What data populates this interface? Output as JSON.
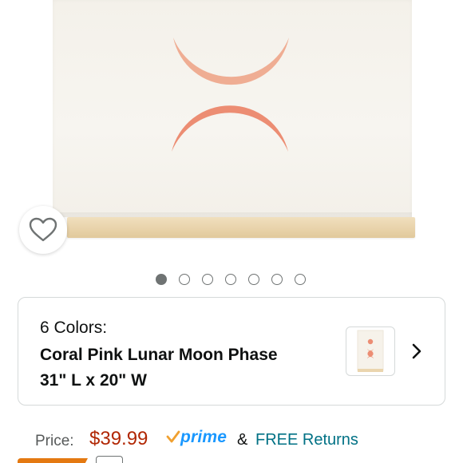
{
  "product_image": {
    "icon": "coral-moon-phase-tapestry-image",
    "moon_colors": [
      "#efad93",
      "#ec8d73"
    ],
    "dowel_color": "#ead5ae"
  },
  "wishlist": {
    "icon": "heart-icon"
  },
  "carousel": {
    "total": 7,
    "active_index": 0
  },
  "variation": {
    "count_label": "6 Colors:",
    "selected_name": "Coral Pink Lunar Moon Phase 31\" L x 20\" W",
    "swatch_icon": "moon-phase-swatch-thumbnail",
    "chevron_icon": "chevron-right-icon"
  },
  "pricing": {
    "label": "Price:",
    "price": "$39.99",
    "prime_check": "✓",
    "prime_text": "prime",
    "amp": "&",
    "returns": "FREE Returns"
  },
  "colors": {
    "price": "#b12704",
    "prime": "#1a98ff",
    "link": "#007185",
    "badge": "#e47911"
  }
}
